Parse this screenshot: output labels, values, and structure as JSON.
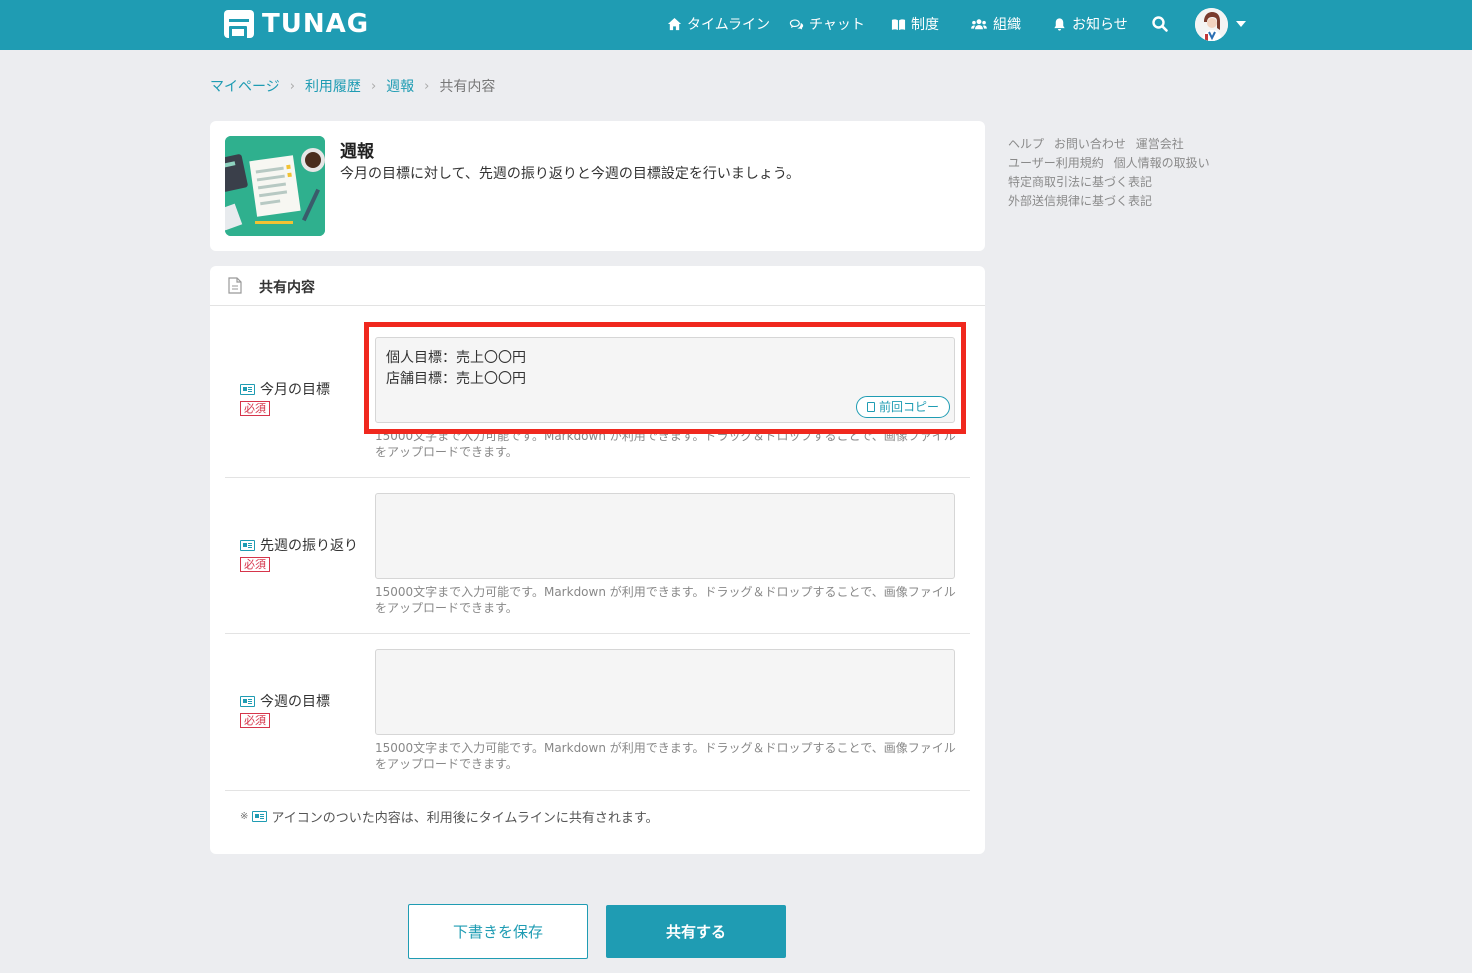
{
  "header": {
    "logo_text": "TUNAG",
    "nav": {
      "timeline": "タイムライン",
      "chat": "チャット",
      "system": "制度",
      "org": "組織",
      "notice": "お知らせ"
    },
    "icons": [
      "home-icon",
      "chat-icon",
      "book-icon",
      "users-icon",
      "bell-icon",
      "search-icon"
    ]
  },
  "breadcrumb": {
    "mypage": "マイページ",
    "history": "利用履歴",
    "weekly": "週報",
    "current": "共有内容",
    "separator": "›"
  },
  "title_card": {
    "title": "週報",
    "description": "今月の目標に対して、先週の振り返りと今週の目標設定を行いましょう。"
  },
  "form": {
    "section_title": "共有内容",
    "required_label": "必須",
    "fields": [
      {
        "label": "今月の目標",
        "value_line1": "個人目標：売上〇〇円",
        "value_line2": "店舗目標：売上〇〇円",
        "copy_button": "前回コピー",
        "hint_line1": "15000文字まで入力可能です。Markdown が利用できます。ドラッグ＆ドロップすることで、画像ファイル",
        "hint_line2": "をアップロードできます。"
      },
      {
        "label": "先週の振り返り",
        "hint_line1": "15000文字まで入力可能です。Markdown が利用できます。ドラッグ＆ドロップすることで、画像ファイル",
        "hint_line2": "をアップロードできます。"
      },
      {
        "label": "今週の目標",
        "hint_line1": "15000文字まで入力可能です。Markdown が利用できます。ドラッグ＆ドロップすることで、画像ファイル",
        "hint_line2": "をアップロードできます。"
      }
    ],
    "footnote_mark": "※",
    "footnote": "アイコンのついた内容は、利用後にタイムラインに共有されます。"
  },
  "side_links": {
    "help": "ヘルプ",
    "contact": "お問い合わせ",
    "company": "運営会社",
    "terms": "ユーザー利用規約",
    "privacy": "個人情報の取扱い",
    "commerce": "特定商取引法に基づく表記",
    "external": "外部送信規律に基づく表記"
  },
  "actions": {
    "save_draft": "下書きを保存",
    "share": "共有する"
  },
  "colors": {
    "brand": "#1f9cb3",
    "required": "#d6354b",
    "highlight": "#f0281e"
  }
}
